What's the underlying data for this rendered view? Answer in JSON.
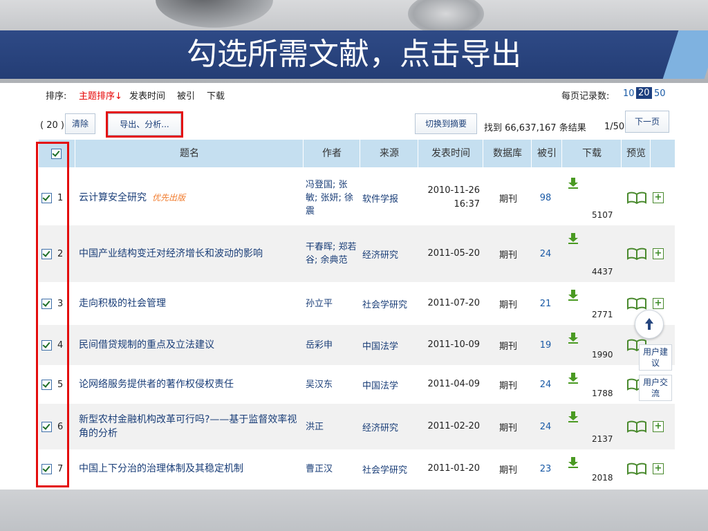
{
  "slide": {
    "title": "勾选所需文献，点击导出"
  },
  "sortbar": {
    "label": "排序:",
    "sort_topic": "主题排序↓",
    "sort_date": "发表时间",
    "sort_cited": "被引",
    "sort_download": "下载",
    "per_page_label": "每页记录数:",
    "per_page_options": [
      "10",
      "20",
      "50"
    ],
    "per_page_selected": "20"
  },
  "toolbar": {
    "selected_count": "( 20 )",
    "clear_label": "清除",
    "export_label": "导出、分析...",
    "switch_label": "切换到摘要",
    "found_text": "找到 66,637,167 条结果",
    "page_indicator": "1/50",
    "next_label": "下一页"
  },
  "table": {
    "headers": {
      "title": "题名",
      "author": "作者",
      "source": "来源",
      "date": "发表时间",
      "database": "数据库",
      "cited": "被引",
      "download": "下载",
      "preview": "预览"
    },
    "rows": [
      {
        "num": "1",
        "title": "云计算安全研究",
        "tag": "优先出版",
        "author": "冯登国; 张敏; 张妍; 徐震",
        "source": "软件学报",
        "date": "2010-11-26 16:37",
        "db": "期刊",
        "cited": "98",
        "downloads": "5107"
      },
      {
        "num": "2",
        "title": "中国产业结构变迁对经济增长和波动的影响",
        "tag": "",
        "author": "干春晖; 郑若谷; 余典范",
        "source": "经济研究",
        "date": "2011-05-20",
        "db": "期刊",
        "cited": "24",
        "downloads": "4437"
      },
      {
        "num": "3",
        "title": "走向积极的社会管理",
        "tag": "",
        "author": "孙立平",
        "source": "社会学研究",
        "date": "2011-07-20",
        "db": "期刊",
        "cited": "21",
        "downloads": "2771"
      },
      {
        "num": "4",
        "title": "民间借贷规制的重点及立法建议",
        "tag": "",
        "author": "岳彩申",
        "source": "中国法学",
        "date": "2011-10-09",
        "db": "期刊",
        "cited": "19",
        "downloads": "1990"
      },
      {
        "num": "5",
        "title": "论网络服务提供者的著作权侵权责任",
        "tag": "",
        "author": "吴汉东",
        "source": "中国法学",
        "date": "2011-04-09",
        "db": "期刊",
        "cited": "24",
        "downloads": "1788"
      },
      {
        "num": "6",
        "title": "新型农村金融机构改革可行吗?——基于监督效率视角的分析",
        "tag": "",
        "author": "洪正",
        "source": "经济研究",
        "date": "2011-02-20",
        "db": "期刊",
        "cited": "24",
        "downloads": "2137"
      },
      {
        "num": "7",
        "title": "中国上下分治的治理体制及其稳定机制",
        "tag": "",
        "author": "曹正汉",
        "source": "社会学研究",
        "date": "2011-01-20",
        "db": "期刊",
        "cited": "23",
        "downloads": "2018"
      }
    ]
  },
  "floating": {
    "feedback_label": "用户建议",
    "exchange_label": "用户交流"
  },
  "icons": {
    "download": "download-arrow-icon",
    "preview": "open-book-icon",
    "add": "plus-icon",
    "back_to_top": "arrow-up-icon",
    "checkbox": "checked-checkbox-icon"
  },
  "colors": {
    "title_band": "#2e4a86",
    "header_row": "#c5dff0",
    "link": "#1a3e78",
    "highlight": "#e40d0d",
    "active_sort": "#e60000",
    "priority_tag": "#f17a2b",
    "download_green": "#4a9a22"
  }
}
